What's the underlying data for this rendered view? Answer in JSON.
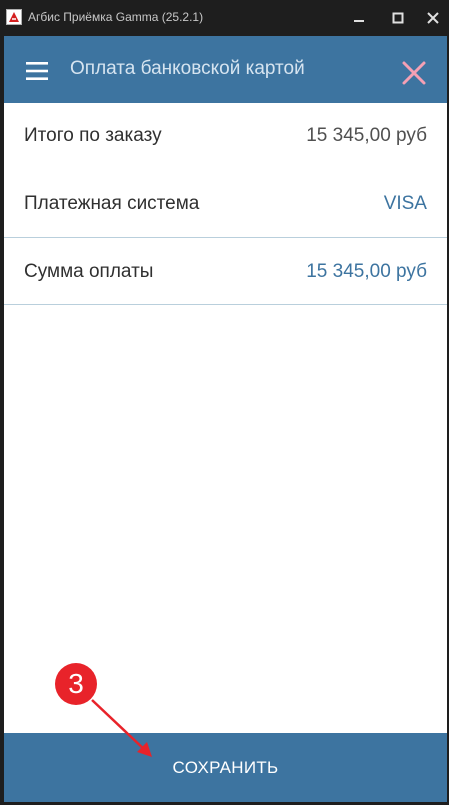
{
  "window": {
    "title": "Агбис Приёмка Gamma (25.2.1)"
  },
  "header": {
    "title": "Оплата банковской картой",
    "close_color": "#f4a0b4"
  },
  "rows": [
    {
      "label": "Итого по заказу",
      "value": "15 345,00 руб",
      "value_color": "#505050"
    },
    {
      "label": "Платежная система",
      "value": "VISA",
      "value_color": "#3d74a0"
    },
    {
      "label": "Сумма оплаты",
      "value": "15 345,00 руб",
      "value_color": "#3d74a0"
    }
  ],
  "footer": {
    "save_label": "СОХРАНИТЬ"
  },
  "annotation": {
    "step_number": "3",
    "color": "#e8232a"
  },
  "colors": {
    "accent": "#3d74a0",
    "divider": "#b9cfdc"
  }
}
